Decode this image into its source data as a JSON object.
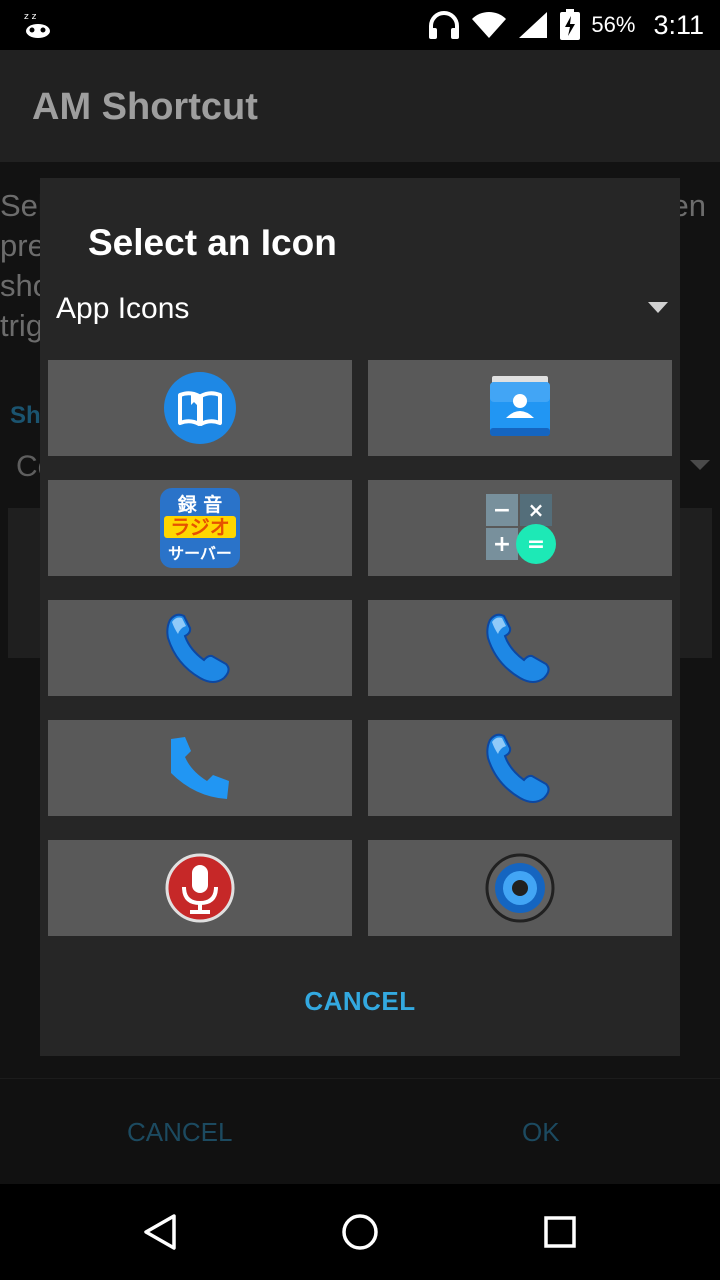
{
  "status_bar": {
    "battery_percent": "56%",
    "time": "3:11",
    "icons": [
      "notification-app-icon",
      "headphones-icon",
      "wifi-icon",
      "signal-icon",
      "battery-charging-icon"
    ]
  },
  "app_bar": {
    "title": "AM Shortcut"
  },
  "background": {
    "desc_left": [
      "Sel",
      "pre",
      "sho",
      "trig"
    ],
    "desc_right": [
      "en"
    ],
    "section_label": "Sh",
    "spinner_value": "Co",
    "footer": {
      "cancel_label": "CANCEL",
      "ok_label": "OK"
    }
  },
  "dialog": {
    "title": "Select an Icon",
    "category": {
      "selected": "App Icons"
    },
    "icons": [
      {
        "name": "book-app-icon"
      },
      {
        "name": "contacts-app-icon"
      },
      {
        "name": "radio-app-icon",
        "text": [
          "録 音",
          "ラジオ",
          "サーバー"
        ]
      },
      {
        "name": "calculator-app-icon",
        "text": [
          "−",
          "×",
          "+",
          "="
        ]
      },
      {
        "name": "phone-glossy-icon"
      },
      {
        "name": "phone-glossy-icon"
      },
      {
        "name": "phone-flat-icon"
      },
      {
        "name": "phone-glossy-icon"
      },
      {
        "name": "microphone-icon"
      },
      {
        "name": "speaker-icon"
      }
    ],
    "cancel_label": "CANCEL"
  },
  "nav_bar": {
    "items": [
      "back-icon",
      "home-icon",
      "recents-icon"
    ]
  },
  "colors": {
    "accent": "#33a9e0",
    "dialog_bg": "#262626",
    "tile_bg": "#595959"
  }
}
